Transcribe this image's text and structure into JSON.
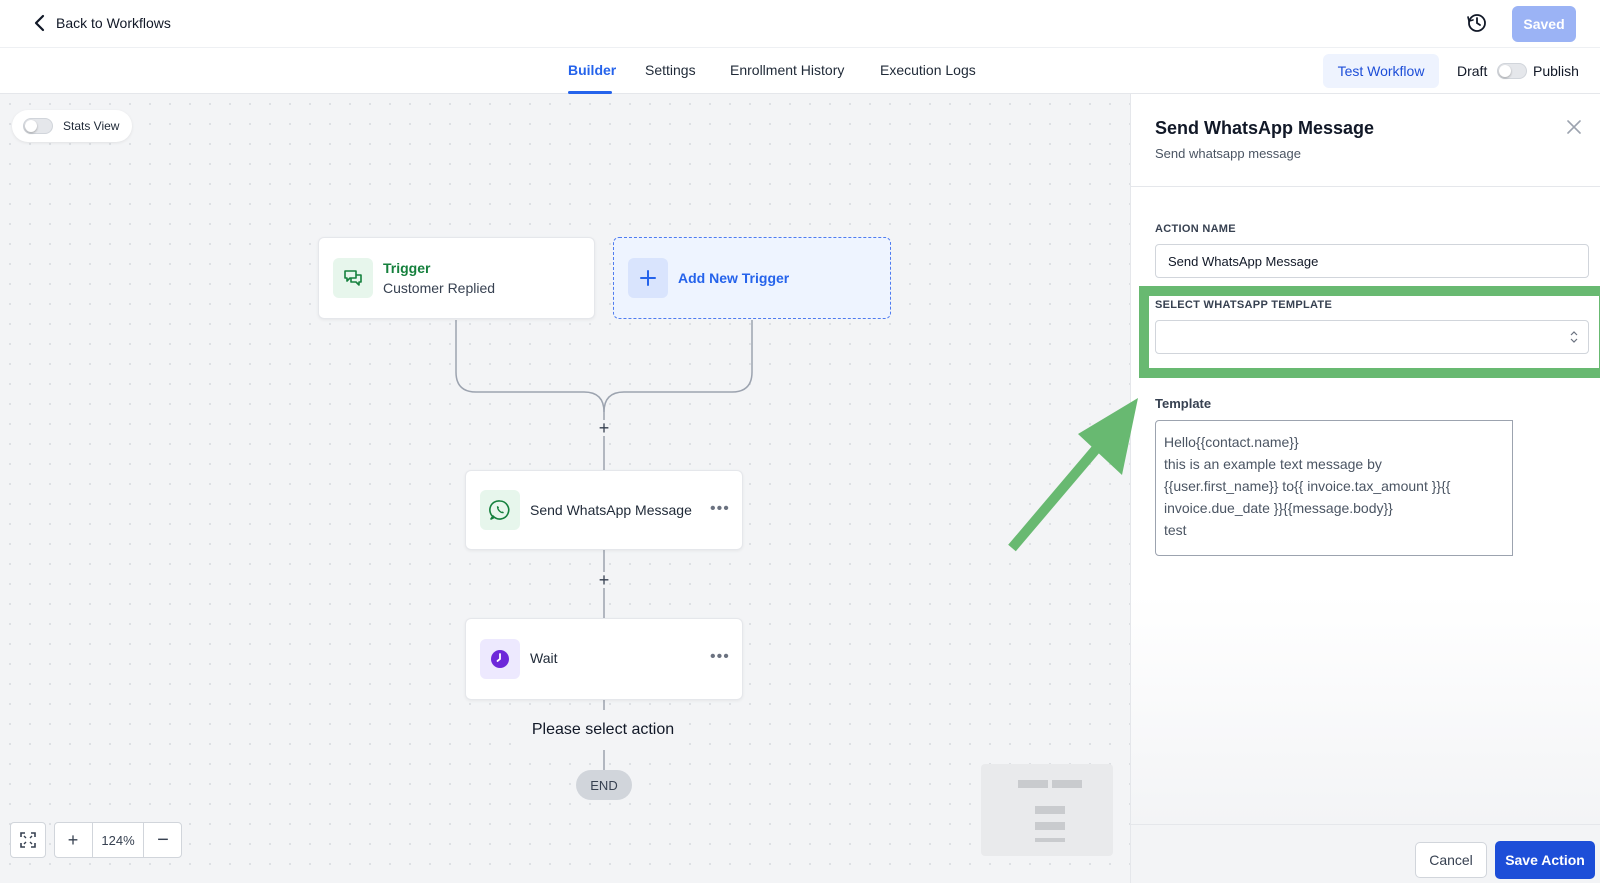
{
  "header": {
    "back_label": "Back to Workflows",
    "saved_label": "Saved"
  },
  "tabs": [
    {
      "label": "Builder",
      "active": true
    },
    {
      "label": "Settings",
      "active": false
    },
    {
      "label": "Enrollment History",
      "active": false
    },
    {
      "label": "Execution Logs",
      "active": false
    }
  ],
  "toolbar": {
    "test_label": "Test Workflow",
    "draft_label": "Draft",
    "publish_label": "Publish"
  },
  "canvas": {
    "stats_label": "Stats View",
    "trigger": {
      "title": "Trigger",
      "subtitle": "Customer Replied",
      "icon": "chat-bubbles-icon"
    },
    "add_trigger_label": "Add New Trigger",
    "action_node": {
      "label": "Send WhatsApp Message",
      "icon": "whatsapp-icon"
    },
    "wait_node": {
      "label": "Wait",
      "icon": "clock-icon"
    },
    "tooltip": "Please select action",
    "end_label": "END",
    "zoom_level": "124%"
  },
  "panel": {
    "title": "Send WhatsApp Message",
    "subtitle": "Send whatsapp message",
    "action_name_label": "ACTION NAME",
    "action_name_value": "Send WhatsApp Message",
    "template_select_label": "SELECT WHATSAPP TEMPLATE",
    "template_select_value": "",
    "template_label": "Template",
    "template_text": "Hello{{contact.name}}\nthis is an example text message by\n{{user.first_name}} to{{ invoice.tax_amount }}{{\ninvoice.due_date }}{{message.body}}\ntest",
    "cancel_label": "Cancel",
    "save_label": "Save Action"
  },
  "colors": {
    "accent": "#2563eb",
    "save_button": "#1d4ed8",
    "saved_button": "#9bb3f5",
    "highlight": "#68b971",
    "trigger_green": "#15803d"
  }
}
